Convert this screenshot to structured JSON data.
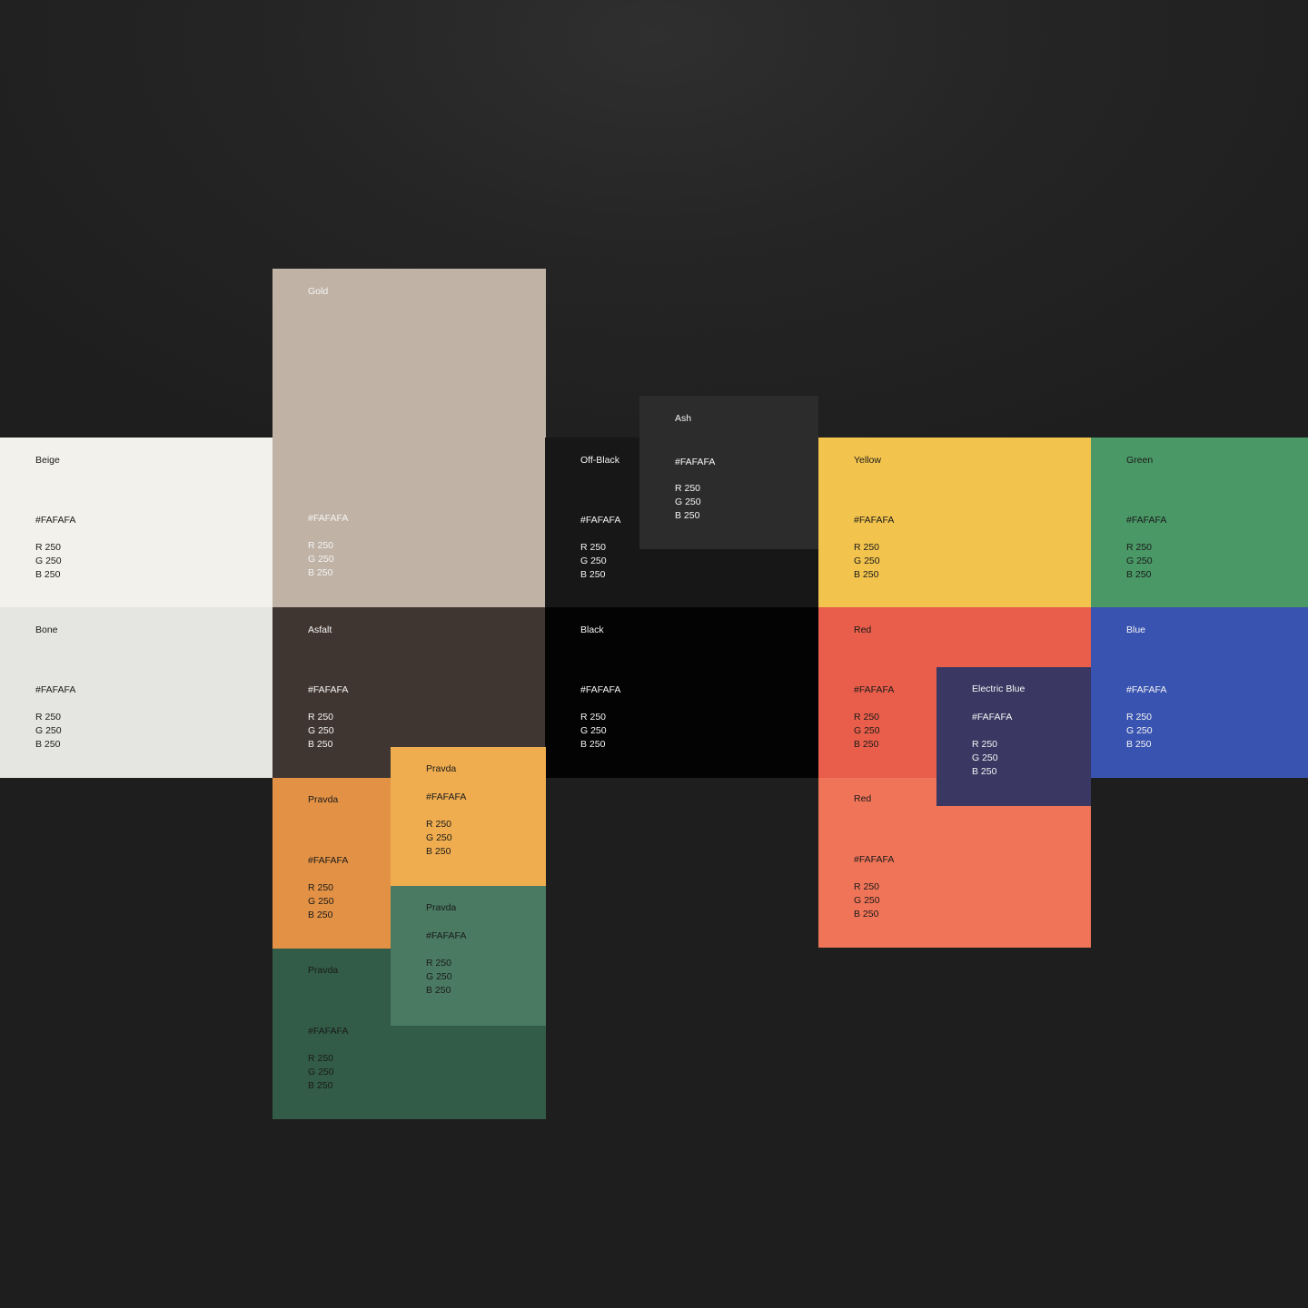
{
  "swatches": {
    "beige": {
      "name": "Beige",
      "hex": "#FAFAFA",
      "r": "R 250",
      "g": "G 250",
      "b": "B 250",
      "color": "#f2f1ec"
    },
    "gold": {
      "name": "Gold",
      "hex": "#FAFAFA",
      "r": "R 250",
      "g": "G 250",
      "b": "B 250",
      "color": "#c0b3a6"
    },
    "off_black": {
      "name": "Off-Black",
      "hex": "#FAFAFA",
      "r": "R 250",
      "g": "G 250",
      "b": "B 250",
      "color": "#171717"
    },
    "ash": {
      "name": "Ash",
      "hex": "#FAFAFA",
      "r": "R 250",
      "g": "G 250",
      "b": "B 250",
      "color": "#2c2c2c"
    },
    "yellow": {
      "name": "Yellow",
      "hex": "#FAFAFA",
      "r": "R 250",
      "g": "G 250",
      "b": "B 250",
      "color": "#f2c44e"
    },
    "green": {
      "name": "Green",
      "hex": "#FAFAFA",
      "r": "R 250",
      "g": "G 250",
      "b": "B 250",
      "color": "#4a9866"
    },
    "bone": {
      "name": "Bone",
      "hex": "#FAFAFA",
      "r": "R 250",
      "g": "G 250",
      "b": "B 250",
      "color": "#e5e5e1"
    },
    "asfalt": {
      "name": "Asfalt",
      "hex": "#FAFAFA",
      "r": "R 250",
      "g": "G 250",
      "b": "B 250",
      "color": "#403631"
    },
    "black": {
      "name": "Black",
      "hex": "#FAFAFA",
      "r": "R 250",
      "g": "G 250",
      "b": "B 250",
      "color": "#030303"
    },
    "red_1": {
      "name": "Red",
      "hex": "#FAFAFA",
      "r": "R 250",
      "g": "G 250",
      "b": "B 250",
      "color": "#e95e4a"
    },
    "blue": {
      "name": "Blue",
      "hex": "#FAFAFA",
      "r": "R 250",
      "g": "G 250",
      "b": "B 250",
      "color": "#3953b0"
    },
    "red_2": {
      "name": "Red",
      "hex": "#FAFAFA",
      "r": "R 250",
      "g": "G 250",
      "b": "B 250",
      "color": "#f07458"
    },
    "electric_blue": {
      "name": "Electric Blue",
      "hex": "#FAFAFA",
      "r": "R 250",
      "g": "G 250",
      "b": "B 250",
      "color": "#3a3862"
    },
    "pravda_orange": {
      "name": "Pravda",
      "hex": "#FAFAFA",
      "r": "R 250",
      "g": "G 250",
      "b": "B 250",
      "color": "#e39245"
    },
    "pravda_dark_green": {
      "name": "Pravda",
      "hex": "#FAFAFA",
      "r": "R 250",
      "g": "G 250",
      "b": "B 250",
      "color": "#325c48"
    },
    "pravda_yellow": {
      "name": "Pravda",
      "hex": "#FAFAFA",
      "r": "R 250",
      "g": "G 250",
      "b": "B 250",
      "color": "#efad4f"
    },
    "pravda_mid_green": {
      "name": "Pravda",
      "hex": "#FAFAFA",
      "r": "R 250",
      "g": "G 250",
      "b": "B 250",
      "color": "#4a7a62"
    }
  }
}
